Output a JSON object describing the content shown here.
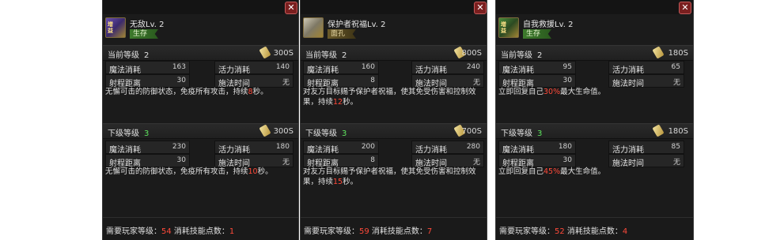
{
  "panels": [
    {
      "icon_text": "增益",
      "name": "无敌Lv. 2",
      "tag": "生存",
      "current_label": "当前等级",
      "current_level": "2",
      "current_cd": "300S",
      "stats_current": {
        "mp_label": "魔法消耗",
        "mp": "163",
        "sp_label": "活力消耗",
        "sp": "140",
        "range_label": "射程距离",
        "range": "30",
        "cast_label": "施法时间",
        "cast": "无"
      },
      "desc_current": [
        "无懈可击的防御状态，免疫所有攻击，持续",
        "8",
        "秒。"
      ],
      "next_label": "下级等级",
      "next_level": "3",
      "next_cd": "300S",
      "stats_next": {
        "mp_label": "魔法消耗",
        "mp": "230",
        "sp_label": "活力消耗",
        "sp": "180",
        "range_label": "射程距离",
        "range": "30",
        "cast_label": "施法时间",
        "cast": "无"
      },
      "desc_next": [
        "无懈可击的防御状态，免疫所有攻击，持续",
        "10",
        "秒。"
      ],
      "footer": {
        "req_label": "需要玩家等级：",
        "req": "54",
        "cost_label": "消耗技能点数：",
        "cost": "1"
      }
    },
    {
      "icon_text": "",
      "name": "保护者祝福Lv. 2",
      "tag": "面孔",
      "current_label": "当前等级",
      "current_level": "2",
      "current_cd": "800S",
      "stats_current": {
        "mp_label": "魔法消耗",
        "mp": "160",
        "sp_label": "活力消耗",
        "sp": "240",
        "range_label": "射程距离",
        "range": "8",
        "cast_label": "施法时间",
        "cast": "无"
      },
      "desc_current": [
        "对友方目标赐予保护者祝福，使其免受伤害和控制效果，持续",
        "12",
        "秒。"
      ],
      "next_label": "下级等级",
      "next_level": "3",
      "next_cd": "700S",
      "stats_next": {
        "mp_label": "魔法消耗",
        "mp": "200",
        "sp_label": "活力消耗",
        "sp": "280",
        "range_label": "射程距离",
        "range": "8",
        "cast_label": "施法时间",
        "cast": "无"
      },
      "desc_next": [
        "对友方目标赐予保护者祝福，使其免受伤害和控制效果，持续",
        "15",
        "秒。"
      ],
      "footer": {
        "req_label": "需要玩家等级：",
        "req": "59",
        "cost_label": "消耗技能点数：",
        "cost": "7"
      }
    },
    {
      "icon_text": "增益",
      "name": "自我救援Lv. 2",
      "tag": "生存",
      "current_label": "当前等级",
      "current_level": "2",
      "current_cd": "180S",
      "stats_current": {
        "mp_label": "魔法消耗",
        "mp": "95",
        "sp_label": "活力消耗",
        "sp": "65",
        "range_label": "射程距离",
        "range": "30",
        "cast_label": "施法时间",
        "cast": "无"
      },
      "desc_current": [
        "立即回复自己",
        "30%",
        "最大生命值。"
      ],
      "next_label": "下级等级",
      "next_level": "3",
      "next_cd": "180S",
      "stats_next": {
        "mp_label": "魔法消耗",
        "mp": "180",
        "sp_label": "活力消耗",
        "sp": "85",
        "range_label": "射程距离",
        "range": "30",
        "cast_label": "施法时间",
        "cast": "无"
      },
      "desc_next": [
        "立即回复自己",
        "45%",
        "最大生命值。"
      ],
      "footer": {
        "req_label": "需要玩家等级：",
        "req": "52",
        "cost_label": "消耗技能点数：",
        "cost": "4"
      }
    }
  ],
  "colors": {
    "highlight_red": "#ff4a3a",
    "next_green": "#5ee45e",
    "tag_green": "#3d7a2c"
  },
  "icons": {
    "close": "close-icon",
    "scroll": "scroll-icon"
  }
}
